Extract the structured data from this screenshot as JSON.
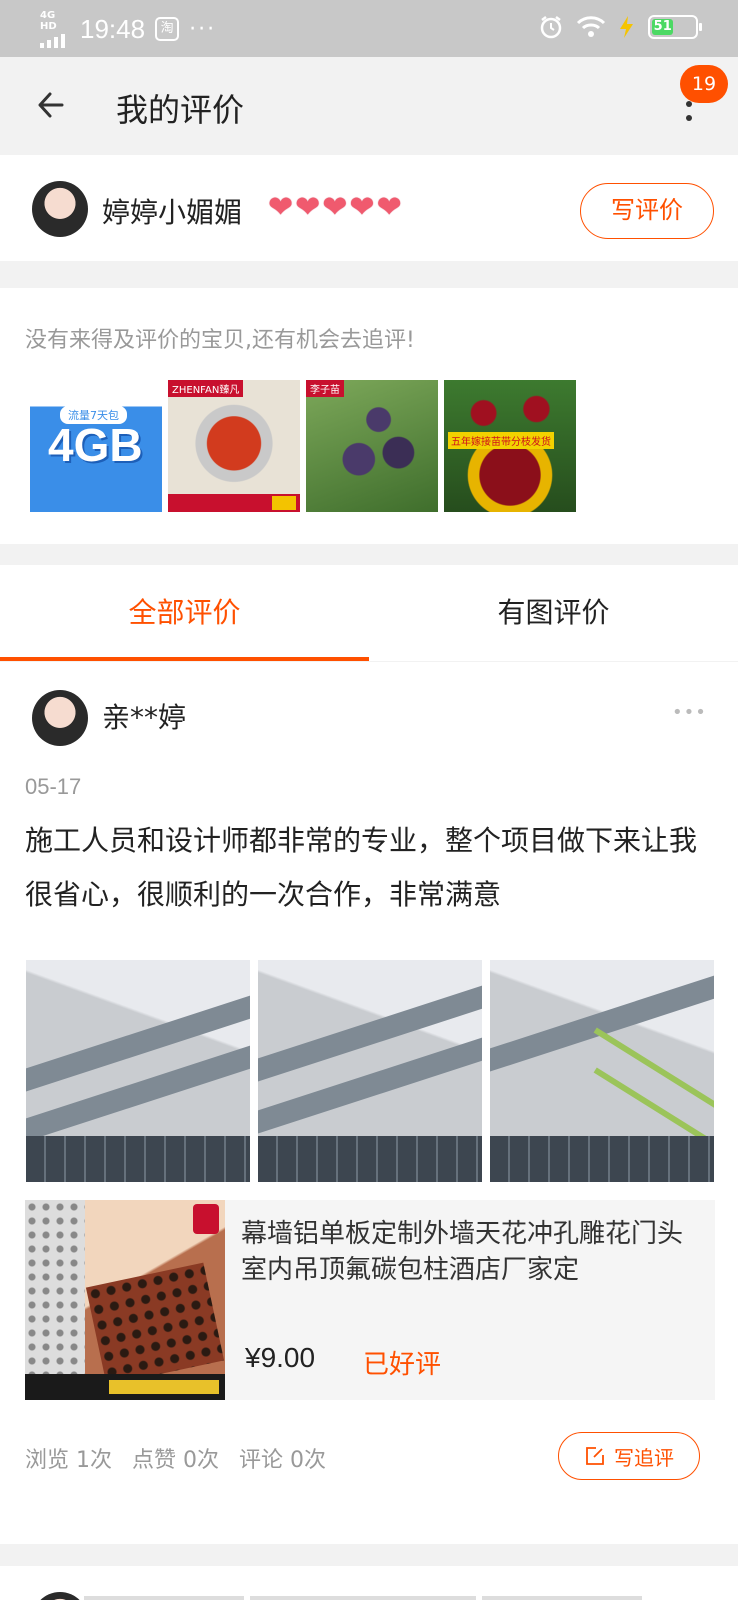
{
  "status_bar": {
    "network": "4G HD",
    "time": "19:48",
    "app_icon": "淘",
    "overflow": "···",
    "battery": "51"
  },
  "header": {
    "title": "我的评价",
    "badge_count": "19"
  },
  "profile": {
    "nickname": "婷婷小媚媚",
    "hearts": [
      "❤",
      "❤",
      "❤",
      "❤",
      "❤"
    ],
    "write_review_label": "写评价"
  },
  "pending": {
    "hint": "没有来得及评价的宝贝,还有机会去追评!",
    "items": [
      {
        "icon": "mobile-data-package-thumb",
        "text": "4GB",
        "sub": "流量7天包"
      },
      {
        "icon": "hotpot-pan-thumb",
        "text": "ZHENFAN臻凡"
      },
      {
        "icon": "plum-fruit-thumb",
        "text": "李子苗"
      },
      {
        "icon": "cherry-fruit-thumb",
        "text": "五年嫁接苗带分枝发货"
      }
    ]
  },
  "tabs": [
    {
      "label": "全部评价",
      "active": true
    },
    {
      "label": "有图评价",
      "active": false
    }
  ],
  "review": {
    "reviewer": "亲**婷",
    "date": "05-17",
    "text": "施工人员和设计师都非常的专业，整个项目做下来让我很省心，很顺利的一次合作，非常满意",
    "photos": [
      "building-facade-photo",
      "building-facade-photo",
      "building-facade-photo"
    ],
    "product": {
      "title": "幕墙铝单板定制外墙天花冲孔雕花门头室内吊顶氟碳包柱酒店厂家定",
      "price": "¥9.00",
      "status": "已好评"
    },
    "stats": {
      "views": "浏览 1次",
      "likes": "点赞 0次",
      "comments": "评论 0次"
    },
    "follow_up_label": "写追评"
  },
  "colors": {
    "accent": "#ff5000",
    "status_bar": "#c8c8c8",
    "page_bg": "#f2f2f2"
  }
}
